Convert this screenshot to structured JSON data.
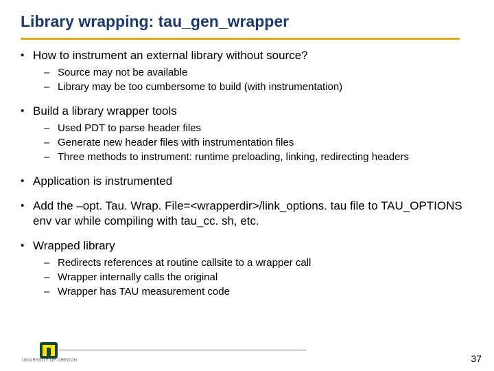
{
  "title": "Library wrapping: tau_gen_wrapper",
  "bullets": [
    {
      "text": "How to instrument an external library without source?",
      "sub": [
        "Source may not be available",
        "Library may be too cumbersome to build (with instrumentation)"
      ]
    },
    {
      "text": "Build a library wrapper tools",
      "sub": [
        "Used PDT to parse header files",
        "Generate new header files with instrumentation files",
        "Three methods to instrument: runtime preloading, linking, redirecting headers"
      ]
    },
    {
      "text": "Application is instrumented",
      "sub": []
    },
    {
      "text": "Add the –opt. Tau. Wrap. File=<wrapperdir>/link_options. tau file to TAU_OPTIONS env var while compiling with tau_cc. sh, etc.",
      "sub": []
    },
    {
      "text": "Wrapped library",
      "sub": [
        "Redirects references at routine callsite to a wrapper call",
        "Wrapper internally calls the original",
        "Wrapper has TAU measurement code"
      ]
    }
  ],
  "footer_org": "UNIVERSITY OF OREGON",
  "page_number": "37"
}
